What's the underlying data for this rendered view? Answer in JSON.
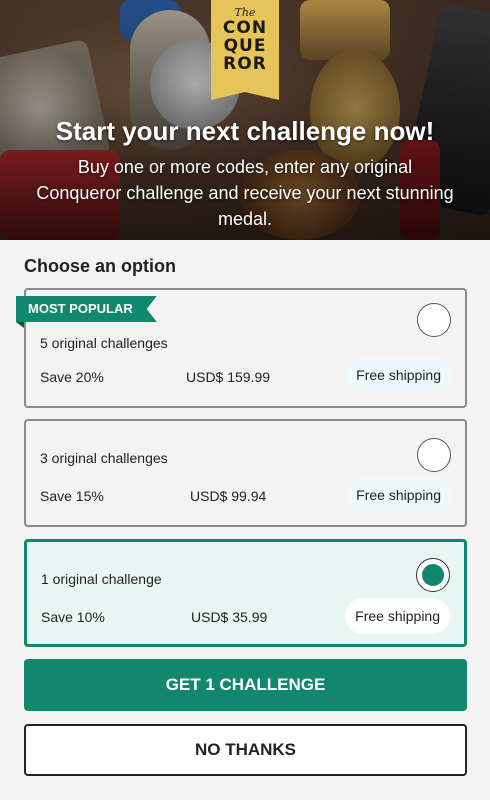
{
  "logo": {
    "the": "The",
    "lines": [
      "CON",
      "QUE",
      "ROR"
    ]
  },
  "hero": {
    "title": "Start your next challenge now!",
    "subtitle": "Buy one or more codes, enter any original Conqueror challenge and receive your next stunning medal."
  },
  "section_title": "Choose an option",
  "badge": "MOST POPULAR",
  "options": [
    {
      "name": "5 original challenges",
      "save": "Save 20%",
      "price": "USD$ 159.99",
      "shipping": "Free shipping",
      "selected": false
    },
    {
      "name": "3 original challenges",
      "save": "Save 15%",
      "price": "USD$ 99.94",
      "shipping": "Free shipping",
      "selected": false
    },
    {
      "name": "1 original challenge",
      "save": "Save 10%",
      "price": "USD$ 35.99",
      "shipping": "Free shipping",
      "selected": true
    }
  ],
  "buttons": {
    "primary": "GET 1 CHALLENGE",
    "secondary": "NO THANKS"
  },
  "colors": {
    "accent": "#11876e",
    "logo": "#e6c45a"
  }
}
